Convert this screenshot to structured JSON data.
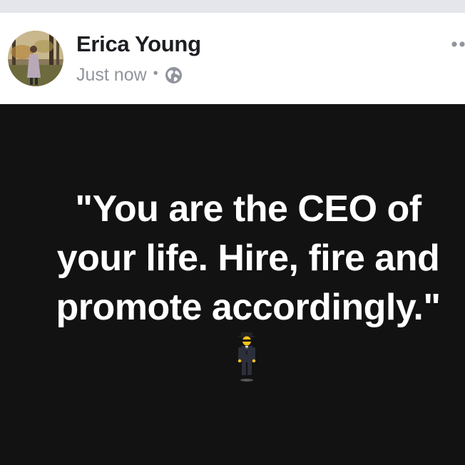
{
  "post": {
    "author": "Erica Young",
    "timestamp": "Just now",
    "separator": "•",
    "privacy_icon": "globe-icon",
    "more_icon": "more-options-icon",
    "quote_lines": [
      "\"You are the CEO of",
      "your life. Hire, fire and",
      "promote accordingly.\""
    ],
    "emoji": "man-in-business-suit-levitating",
    "colors": {
      "background": "#121212",
      "text": "#ffffff",
      "name": "#1c1e21",
      "meta": "#90949c"
    }
  }
}
